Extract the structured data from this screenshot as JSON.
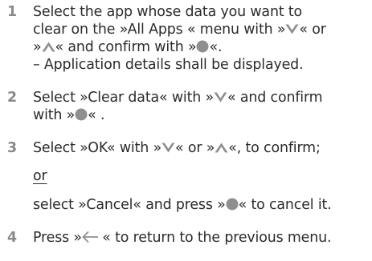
{
  "steps": [
    {
      "number": "1",
      "lines": [
        {
          "text": "Select the app whose data you want to"
        },
        {
          "a": "clear on the »All Apps « menu with »",
          "b": "« or"
        },
        {
          "a": "»",
          "b": "« and confirm with »",
          "c": "«."
        },
        {
          "text": "– Application details shall be displayed."
        }
      ]
    },
    {
      "number": "2",
      "lines": [
        {
          "a": "Select »Clear data« with »",
          "b": "« and confirm"
        },
        {
          "a": "with »",
          "b": "« ."
        }
      ]
    },
    {
      "number": "3",
      "lines": [
        {
          "a": "Select »OK« with »",
          "b": "« or »",
          "c": "«, to confirm;"
        },
        {
          "text": "or"
        },
        {
          "a": "select »Cancel« and press »",
          "b": "« to cancel it."
        }
      ]
    },
    {
      "number": "4",
      "lines": [
        {
          "a": "Press »",
          "b": " « to return to the previous menu."
        }
      ]
    }
  ],
  "icons": {
    "down": "chevron-down-icon",
    "up": "chevron-up-icon",
    "ok": "ok-circle-icon",
    "back": "back-arrow-icon"
  },
  "colors": {
    "text": "#2b2b2b",
    "step_number": "#8a8a8a",
    "icon": "#8f8f8f"
  }
}
